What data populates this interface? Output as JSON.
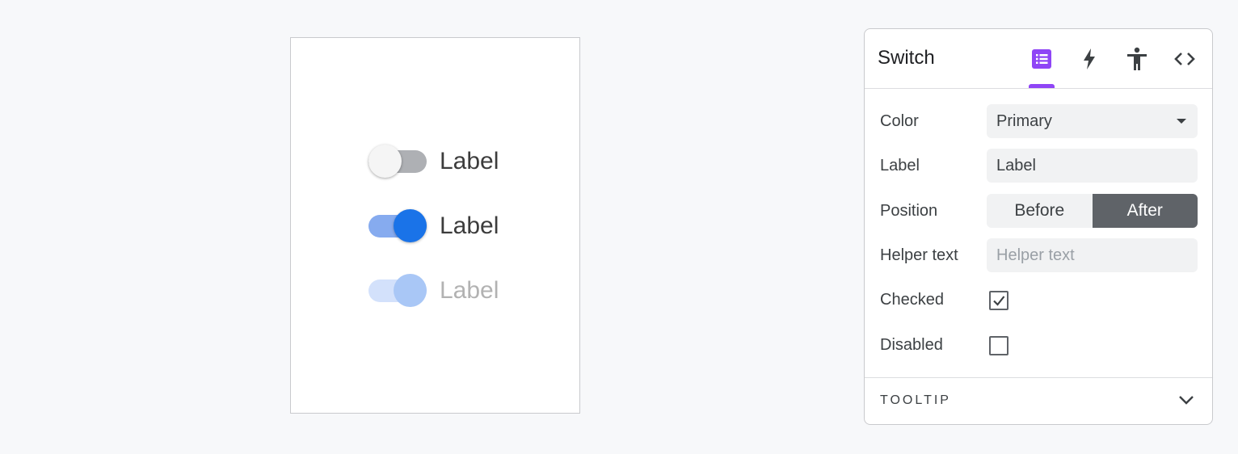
{
  "preview": {
    "switches": [
      {
        "label": "Label",
        "state": "off"
      },
      {
        "label": "Label",
        "state": "on"
      },
      {
        "label": "Label",
        "state": "disabled-on"
      }
    ]
  },
  "panel": {
    "title": "Switch",
    "tabs": [
      {
        "icon": "list-icon",
        "active": true
      },
      {
        "icon": "lightning-icon",
        "active": false
      },
      {
        "icon": "accessibility-icon",
        "active": false
      },
      {
        "icon": "code-icon",
        "active": false
      }
    ],
    "properties": {
      "color": {
        "label": "Color",
        "value": "Primary"
      },
      "label": {
        "label": "Label",
        "value": "Label"
      },
      "position": {
        "label": "Position",
        "options": [
          "Before",
          "After"
        ],
        "selected": "After"
      },
      "helper_text": {
        "label": "Helper text",
        "placeholder": "Helper text",
        "value": ""
      },
      "checked": {
        "label": "Checked",
        "value": true
      },
      "disabled": {
        "label": "Disabled",
        "value": false
      }
    },
    "tooltip_section": {
      "label": "TOOLTIP",
      "expanded": false
    }
  },
  "colors": {
    "accent": "#8f45f6",
    "switch_on": "#1a73e8",
    "segment_active": "#5f6368"
  }
}
